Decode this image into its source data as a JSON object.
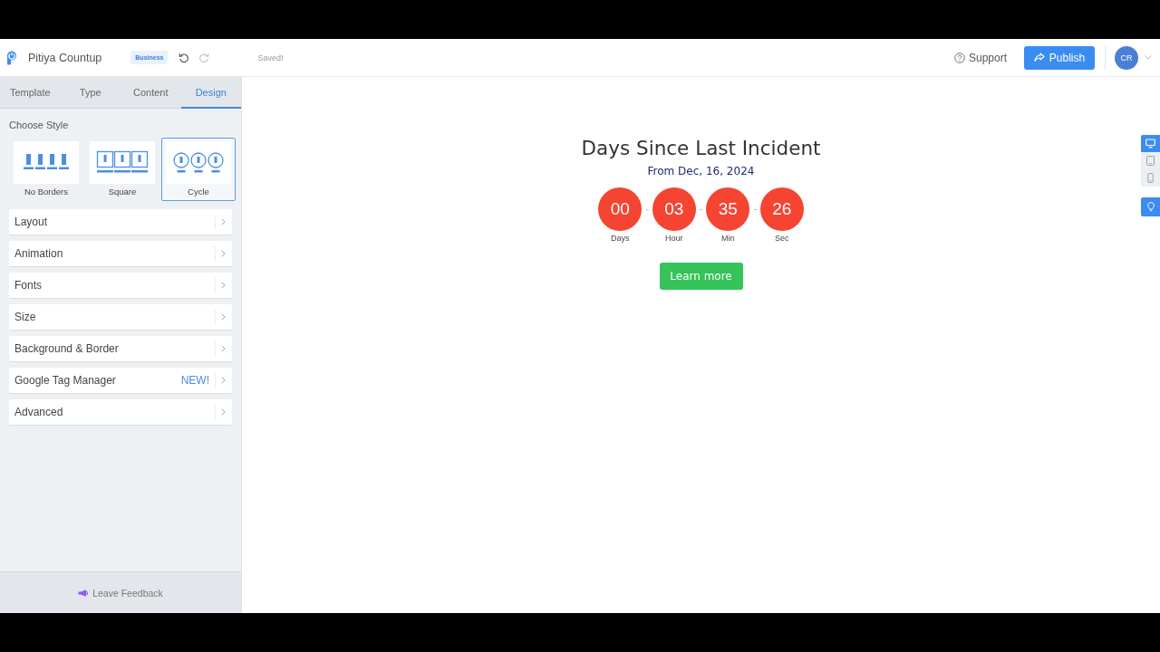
{
  "header": {
    "app_name": "Pitiya Countup",
    "plan_badge": "Business",
    "undo": {
      "disabled": false
    },
    "redo": {
      "disabled": true
    },
    "save_status": "Saved!",
    "support_link": "Support",
    "publish_button": "Publish",
    "avatar_initials": "CR"
  },
  "sidebar": {
    "tabs": [
      {
        "label": "Template",
        "selected": false
      },
      {
        "label": "Type",
        "selected": false
      },
      {
        "label": "Content",
        "selected": false
      },
      {
        "label": "Design",
        "selected": true
      }
    ],
    "section_title": "Choose Style",
    "styles": [
      {
        "label": "No Borders",
        "kind": "plain",
        "selected": false
      },
      {
        "label": "Square",
        "kind": "square",
        "selected": false
      },
      {
        "label": "Cycle",
        "kind": "circle",
        "selected": true
      }
    ],
    "panels": [
      {
        "label": "Layout"
      },
      {
        "label": "Animation"
      },
      {
        "label": "Fonts"
      },
      {
        "label": "Size"
      },
      {
        "label": "Background & Border"
      },
      {
        "label": "Google Tag Manager",
        "badge": "NEW!"
      },
      {
        "label": "Advanced"
      }
    ],
    "feedback_link": "Leave Feedback"
  },
  "preview": {
    "title": "Days Since Last Incident",
    "subtitle": "From Dec, 16, 2024",
    "units": [
      {
        "value": "00",
        "label": "Days"
      },
      {
        "value": "03",
        "label": "Hour"
      },
      {
        "value": "35",
        "label": "Min"
      },
      {
        "value": "26",
        "label": "Sec"
      }
    ],
    "cta_button": "Learn more"
  },
  "device_toolbar": {
    "devices": [
      {
        "kind": "desktop",
        "selected": true
      },
      {
        "kind": "tablet",
        "selected": false
      },
      {
        "kind": "mobile",
        "selected": false
      }
    ]
  }
}
